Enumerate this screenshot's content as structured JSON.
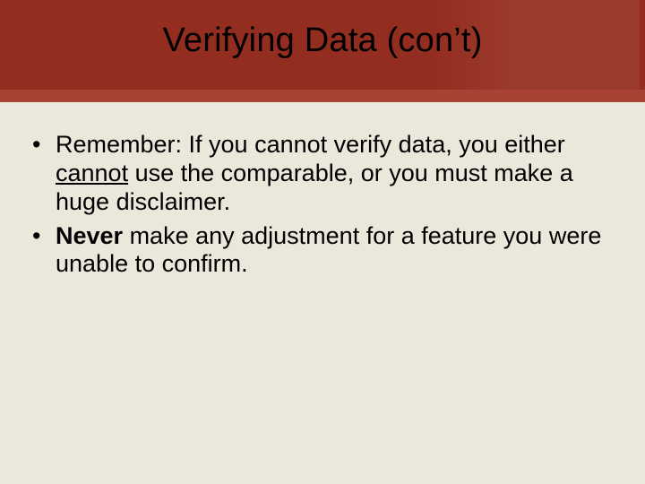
{
  "title": "Verifying Data (con’t)",
  "bullets": [
    {
      "runs": [
        {
          "t": "Remember: If you cannot verify data, you either "
        },
        {
          "t": "cannot",
          "style": "u"
        },
        {
          "t": " use the comparable, or you must make a huge disclaimer."
        }
      ]
    },
    {
      "runs": [
        {
          "t": "Never",
          "style": "b"
        },
        {
          "t": " make any adjustment for a feature you were unable to confirm."
        }
      ]
    }
  ],
  "bullet_marker": "•"
}
